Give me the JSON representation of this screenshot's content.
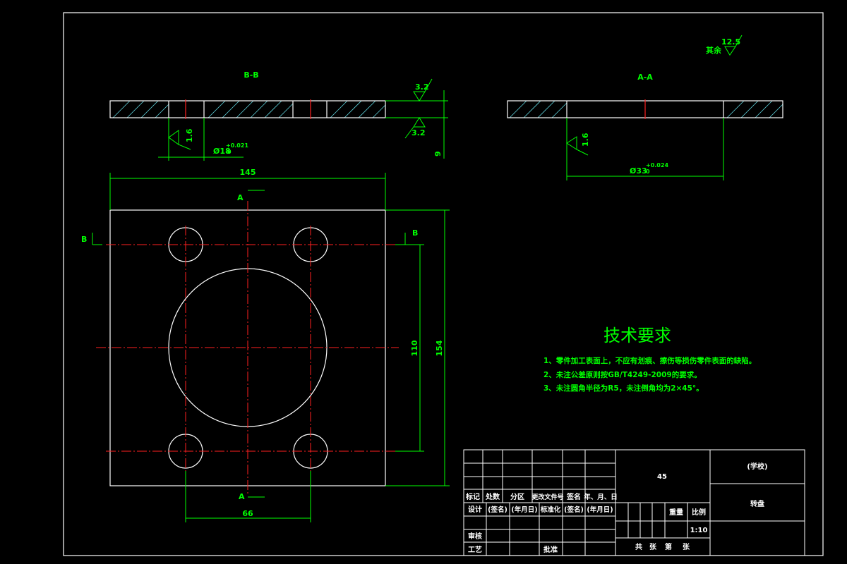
{
  "drawing": {
    "colors": {
      "outline": "#ffffff",
      "dimension": "#00ff00",
      "centerline": "#ff2020",
      "hatch": "#60d8e0",
      "background": "#000000"
    },
    "section_bb": {
      "label": "B-B",
      "roughness_top": "3.2",
      "roughness_bottom": "3.2",
      "roughness_hole": "1.6",
      "hole_dim": "Ø18",
      "hole_tol_upper": "+0.021",
      "hole_tol_lower": "0",
      "thickness": "9"
    },
    "section_aa": {
      "label": "A-A",
      "roughness_hole": "1.6",
      "bore_dim": "Ø33",
      "bore_tol_upper": "+0.024",
      "bore_tol_lower": "0"
    },
    "other_roughness": {
      "label": "其余",
      "value": "12.5"
    },
    "main_view": {
      "width": "145",
      "height": "154",
      "hole_spacing_v": "110",
      "hole_spacing_h": "66",
      "cut_a_top": "A",
      "cut_a_bottom": "A",
      "cut_b_left": "B",
      "cut_b_right": "B"
    },
    "tech_req": {
      "title": "技术要求",
      "items": [
        "1、零件加工表面上，不应有划痕、擦伤等损伤零件表面的缺陷。",
        "2、未注公差原则按GB/T4249-2009的要求。",
        "3、未注圆角半径为R5，未注倒角均为2×45°。"
      ]
    },
    "title_block": {
      "header": [
        "标记",
        "处数",
        "分区",
        "更改文件号",
        "签名",
        "年、月、日"
      ],
      "design_row": [
        "设计",
        "(签名)",
        "(年月日)",
        "标准化",
        "(签名)",
        "(年月日)"
      ],
      "review": "审核",
      "process": "工艺",
      "approve": "批准",
      "material": "45",
      "school": "(学校)",
      "part_name": "转盘",
      "weight_label": "重量",
      "scale_label": "比例",
      "scale": "1:10",
      "sheets": [
        "共",
        "张",
        "第",
        "张"
      ]
    }
  }
}
